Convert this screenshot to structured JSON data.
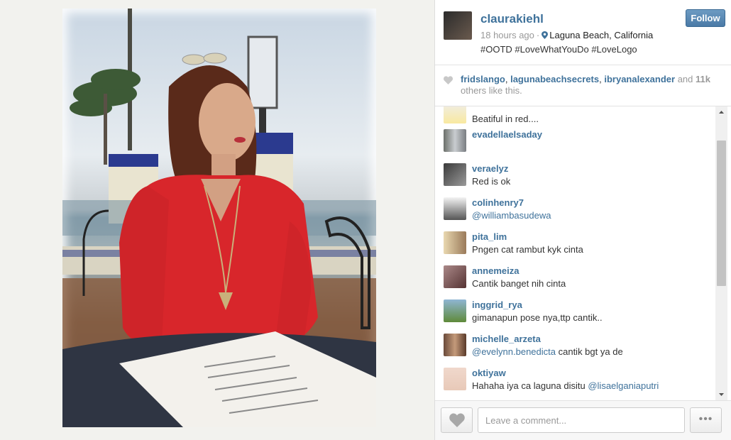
{
  "post": {
    "username": "claurakiehl",
    "time_ago": "18 hours ago",
    "separator": "·",
    "location": "Laguna Beach, California",
    "caption": " #OOTD #LoveWhatYouDo #LoveLogo",
    "follow_label": "Follow"
  },
  "likes": {
    "users": [
      "fridslango",
      "lagunabeachsecrets",
      "ibryanalexander"
    ],
    "comma": ",",
    "and_text": "and",
    "count": "11k",
    "others_text": "others like this."
  },
  "comments": [
    {
      "user": "",
      "text": " Beatiful in red...."
    },
    {
      "user": "evadellaelsaday",
      "text": ""
    },
    {
      "user": "veraelyz",
      "text": "Red is ok"
    },
    {
      "user": "colinhenry7",
      "mention": "@williambasudewa",
      "text": ""
    },
    {
      "user": "pita_lim",
      "text": "Pngen cat rambut kyk cinta"
    },
    {
      "user": "annemeiza",
      "text": "Cantik banget nih cinta "
    },
    {
      "user": "inggrid_rya",
      "text": "gimanapun pose nya,ttp cantik.."
    },
    {
      "user": "michelle_arzeta",
      "mention": "@evelynn.benedicta",
      "text": " cantik bgt ya de"
    },
    {
      "user": "oktiyaw",
      "text": "Hahaha iya ca laguna disitu ",
      "mention_after": "@lisaelganiaputri"
    }
  ],
  "footer": {
    "comment_placeholder": "Leave a comment...",
    "more_label": "•••"
  },
  "colors": {
    "link": "#3f729b",
    "follow_button": "#4a7aa6",
    "dress_red": "#d8262b"
  },
  "icons": [
    "location-pin-icon",
    "heart-icon",
    "scroll-up-icon",
    "scroll-down-icon",
    "more-icon"
  ]
}
